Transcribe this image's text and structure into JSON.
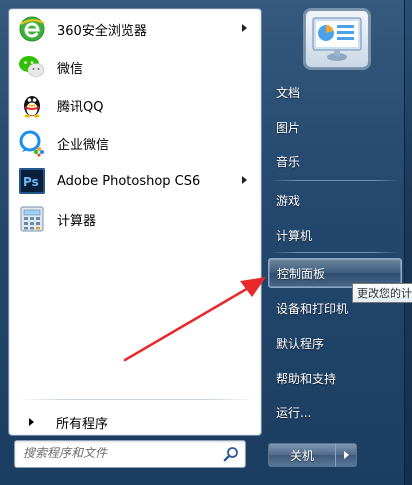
{
  "left_pane": {
    "programs": [
      {
        "label": "360安全浏览器",
        "icon": "browser-360-icon",
        "has_submenu": true
      },
      {
        "label": "微信",
        "icon": "wechat-icon",
        "has_submenu": false
      },
      {
        "label": "腾讯QQ",
        "icon": "qq-penguin-icon",
        "has_submenu": false
      },
      {
        "label": "企业微信",
        "icon": "wecom-icon",
        "has_submenu": false
      },
      {
        "label": "Adobe Photoshop CS6",
        "icon": "photoshop-icon",
        "has_submenu": true
      },
      {
        "label": "计算器",
        "icon": "calculator-icon",
        "has_submenu": false
      }
    ],
    "all_programs_label": "所有程序",
    "search_placeholder": "搜索程序和文件"
  },
  "right_pane": {
    "items": [
      {
        "label": "文档"
      },
      {
        "label": "图片"
      },
      {
        "label": "音乐"
      },
      {
        "label": "游戏"
      },
      {
        "label": "计算机"
      },
      {
        "label": "控制面板",
        "hovered": true
      },
      {
        "label": "设备和打印机"
      },
      {
        "label": "默认程序"
      },
      {
        "label": "帮助和支持"
      },
      {
        "label": "运行..."
      }
    ],
    "shutdown_label": "关机"
  },
  "tooltip": {
    "text": "更改您的计"
  },
  "colors": {
    "menu_bg": "#24486e",
    "annotation_arrow": "#e8282b"
  }
}
